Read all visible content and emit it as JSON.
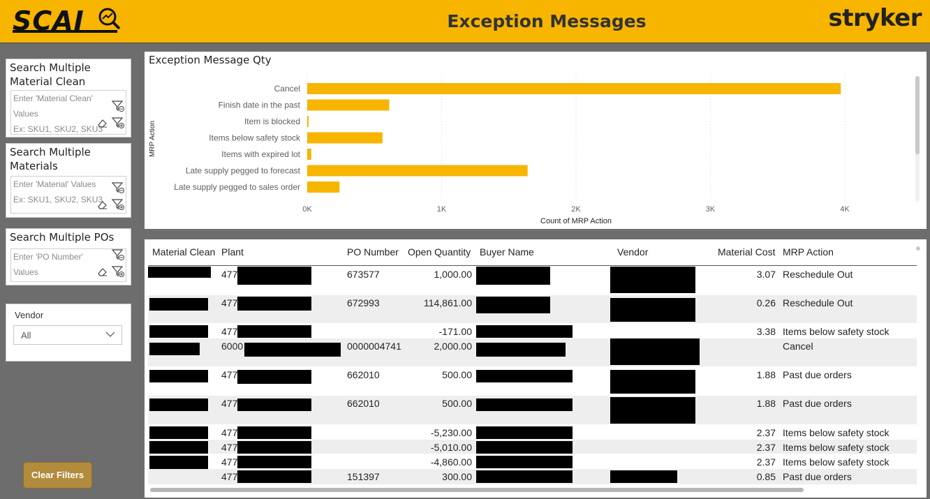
{
  "header": {
    "logo_left": "SCAI",
    "title": "Exception Messages",
    "logo_right": "stryker",
    "background": "#f7b500"
  },
  "slicers": {
    "material_clean": {
      "title": "Search Multiple Material Clean",
      "placeholder_lines": [
        "Enter 'Material Clean'",
        "Values",
        "Ex: SKU1, SKU2, SKU3"
      ],
      "icons": [
        "filter-clear-icon",
        "eraser-icon",
        "filter-add-icon"
      ]
    },
    "materials": {
      "title": "Search Multiple Materials",
      "placeholder_lines": [
        "Enter 'Material' Values",
        "Ex: SKU1, SKU2, SKU3"
      ],
      "icons": [
        "filter-clear-icon",
        "eraser-icon",
        "filter-add-icon"
      ]
    },
    "pos": {
      "title": "Search Multiple POs",
      "placeholder_lines": [
        "Enter 'PO Number'",
        "Values"
      ],
      "icons": [
        "filter-clear-icon",
        "eraser-icon",
        "filter-add-icon"
      ]
    },
    "vendor": {
      "label": "Vendor",
      "selected": "All"
    }
  },
  "clear_filters_label": "Clear Filters",
  "chart": {
    "title": "Exception Message Qty"
  },
  "chart_data": {
    "type": "bar",
    "orientation": "horizontal",
    "categories": [
      "Cancel",
      "Finish date in the past",
      "Item is blocked",
      "Items below safety stock",
      "Items with expired lot",
      "Late supply pegged to forecast",
      "Late supply pegged to sales order"
    ],
    "values": [
      3970,
      610,
      10,
      560,
      30,
      1640,
      240
    ],
    "xlabel": "Count of MRP Action",
    "ylabel": "MRP Action",
    "xlim": [
      0,
      4000
    ],
    "xticks": [
      0,
      1000,
      2000,
      3000,
      4000
    ],
    "xtick_labels": [
      "0K",
      "1K",
      "2K",
      "3K",
      "4K"
    ],
    "bar_color": "#f7b500",
    "grid": "vertical dotted"
  },
  "table": {
    "columns": [
      "Material Clean",
      "Plant",
      "PO Number",
      "Open Quantity",
      "Buyer Name",
      "Vendor",
      "Material Cost",
      "MRP Action"
    ],
    "rows": [
      {
        "plant": "477",
        "po": "673577",
        "qty": "1,000.00",
        "cost": "3.07",
        "action": "Reschedule Out"
      },
      {
        "plant": "477",
        "po": "672993",
        "qty": "114,861.00",
        "cost": "0.26",
        "action": "Reschedule Out"
      },
      {
        "plant": "477",
        "po": "",
        "qty": "-171.00",
        "cost": "3.38",
        "action": "Items below safety stock"
      },
      {
        "plant": "6000",
        "po": "0000004741",
        "qty": "2,000.00",
        "cost": "",
        "action": "Cancel"
      },
      {
        "plant": "477",
        "po": "662010",
        "qty": "500.00",
        "cost": "1.88",
        "action": "Past due orders"
      },
      {
        "plant": "477",
        "po": "662010",
        "qty": "500.00",
        "cost": "1.88",
        "action": "Past due orders"
      },
      {
        "plant": "477",
        "po": "",
        "qty": "-5,230.00",
        "cost": "2.37",
        "action": "Items below safety stock"
      },
      {
        "plant": "477",
        "po": "",
        "qty": "-5,010.00",
        "cost": "2.37",
        "action": "Items below safety stock"
      },
      {
        "plant": "477",
        "po": "",
        "qty": "-4,860.00",
        "cost": "2.37",
        "action": "Items below safety stock"
      },
      {
        "plant": "477",
        "po": "151397",
        "qty": "300.00",
        "cost": "0.85",
        "action": "Past due orders"
      }
    ]
  }
}
